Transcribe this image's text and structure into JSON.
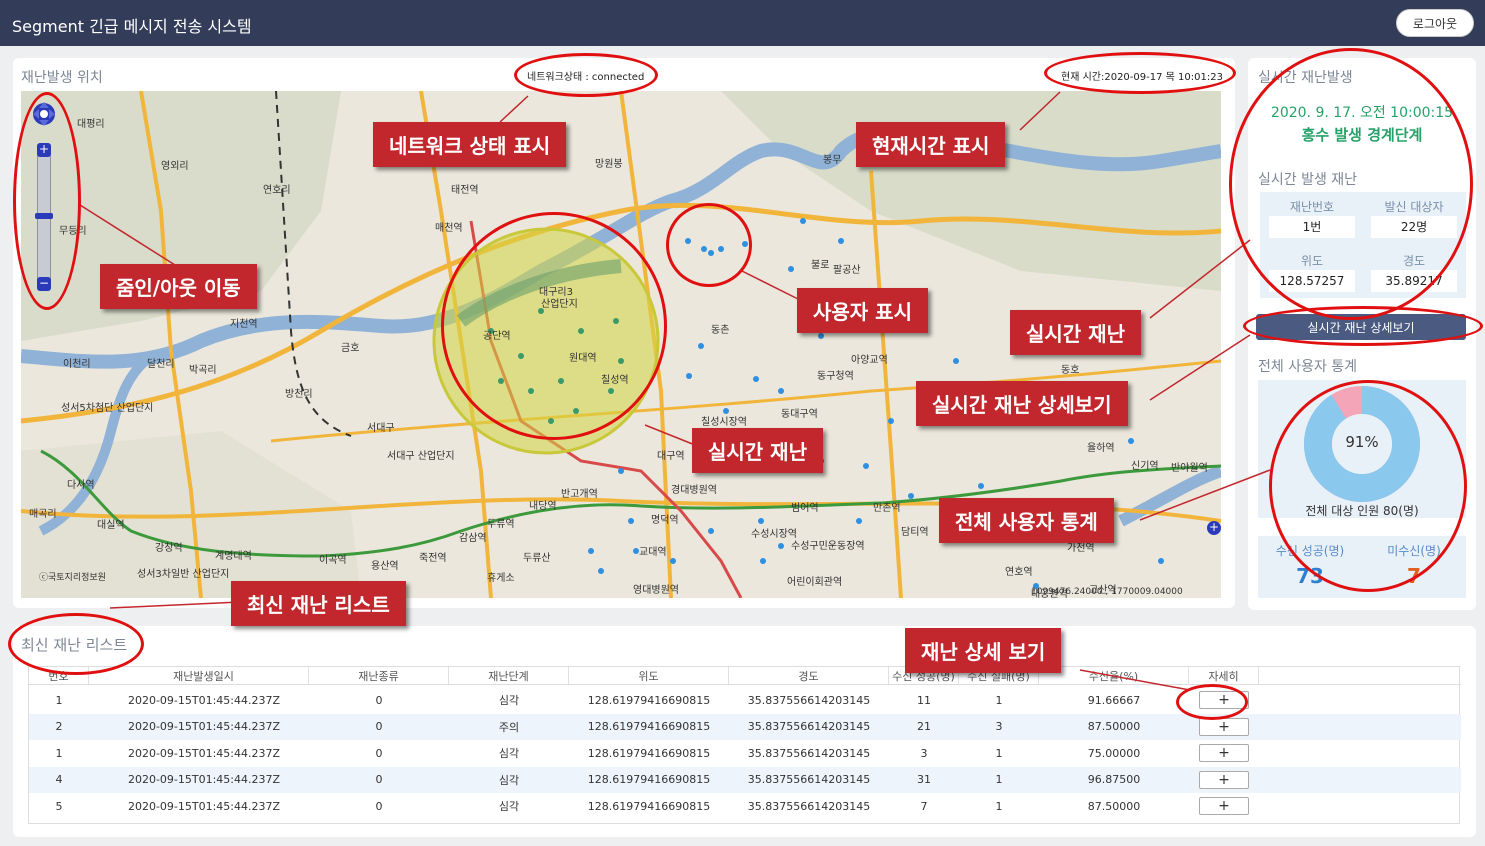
{
  "app": {
    "title": "Segment 긴급 메시지 전송 시스템",
    "logout_label": "로그아웃"
  },
  "map_panel": {
    "title": "재난발생 위치",
    "network_status": "네트워크상태 : connected",
    "current_time": "현재 시간:2020-09-17 목 10:01:23",
    "copyright": "ⓒ국토지리정보원",
    "coords": "1099476.24000 , 1770009.04000",
    "place_labels": [
      "대평리",
      "영외리",
      "연호리",
      "무등리",
      "지천역",
      "이천리",
      "달천리",
      "박곡리",
      "방천리",
      "성서5차첨단 산업단지",
      "다사역",
      "매곡리",
      "대실역",
      "강창역",
      "계명대역",
      "성서3차일반 산업단지",
      "태전역",
      "매천역",
      "망원봉",
      "서대구",
      "서대구 산업단지",
      "금호",
      "봉무",
      "동호",
      "불로",
      "팔공산",
      "아양교역",
      "동구청역",
      "동대구역",
      "칠성시장역",
      "대구역",
      "경대병원역",
      "반고개역",
      "내당역",
      "두류역",
      "감삼역",
      "명덕역",
      "교대역",
      "영대병원역",
      "범어역",
      "수성시장역",
      "수성구민운동장역",
      "어린이회관역",
      "만촌역",
      "율하역",
      "신기역",
      "반야월역",
      "담티역",
      "가천역",
      "연호역",
      "대공원역",
      "고산역",
      "죽전역",
      "이곡역",
      "용산역",
      "휴게소",
      "두류산",
      "동촌"
    ],
    "overlay_labels": [
      "대구리3",
      "산업단지",
      "공단역",
      "원대역",
      "칠성역"
    ]
  },
  "annotations": {
    "network": "네트워크 상태 표시",
    "time": "현재시간 표시",
    "zoom": "줌인/아웃 이동",
    "users": "사용자 표시",
    "realtime1": "실시간 재난",
    "realtime_detail": "실시간 재난 상세보기",
    "realtime2": "실시간 재난",
    "total_stats": "전체 사용자 통계",
    "latest_list": "최신 재난 리스트",
    "detail_view": "재난 상세 보기"
  },
  "side_panel": {
    "title": "실시간 재난발생",
    "date": "2020. 9. 17. 오전 10:00:15",
    "status": "홍수 발생 경계단계",
    "subtitle": "실시간 발생 재난",
    "labels": {
      "id": "재난번호",
      "target": "발신 대상자",
      "lat": "위도",
      "lng": "경도"
    },
    "values": {
      "id": "1번",
      "target": "22명",
      "lat": "128.57257",
      "lng": "35.89217"
    },
    "detail_button": "실시간 재난 상세보기",
    "stats_title": "전체 사용자 통계",
    "success_percent": 91,
    "percent_label": "91%",
    "total_label": "전체 대상 인원 80(명)",
    "success_label": "수신 성공(명)",
    "success_value": "73",
    "fail_label": "미수신(명)",
    "fail_value": "7",
    "colors": {
      "success": "#8ac8ee",
      "fail": "#f4a6b8",
      "status": "#26a269"
    }
  },
  "list_panel": {
    "title": "최신 재난 리스트",
    "headers": [
      "번호",
      "재난발생일시",
      "재난종류",
      "재난단계",
      "위도",
      "경도",
      "수신 성공(명)",
      "수신 실패(명)",
      "수신율(%)",
      "자세히"
    ],
    "rows": [
      [
        "1",
        "2020-09-15T01:45:44.237Z",
        "0",
        "심각",
        "128.61979416690815",
        "35.837556614203145",
        "11",
        "1",
        "91.66667",
        "+"
      ],
      [
        "2",
        "2020-09-15T01:45:44.237Z",
        "0",
        "주의",
        "128.61979416690815",
        "35.837556614203145",
        "21",
        "3",
        "87.50000",
        "+"
      ],
      [
        "1",
        "2020-09-15T01:45:44.237Z",
        "0",
        "심각",
        "128.61979416690815",
        "35.837556614203145",
        "3",
        "1",
        "75.00000",
        "+"
      ],
      [
        "4",
        "2020-09-15T01:45:44.237Z",
        "0",
        "심각",
        "128.61979416690815",
        "35.837556614203145",
        "31",
        "1",
        "96.87500",
        "+"
      ],
      [
        "5",
        "2020-09-15T01:45:44.237Z",
        "0",
        "심각",
        "128.61979416690815",
        "35.837556614203145",
        "7",
        "1",
        "87.50000",
        "+"
      ]
    ]
  }
}
